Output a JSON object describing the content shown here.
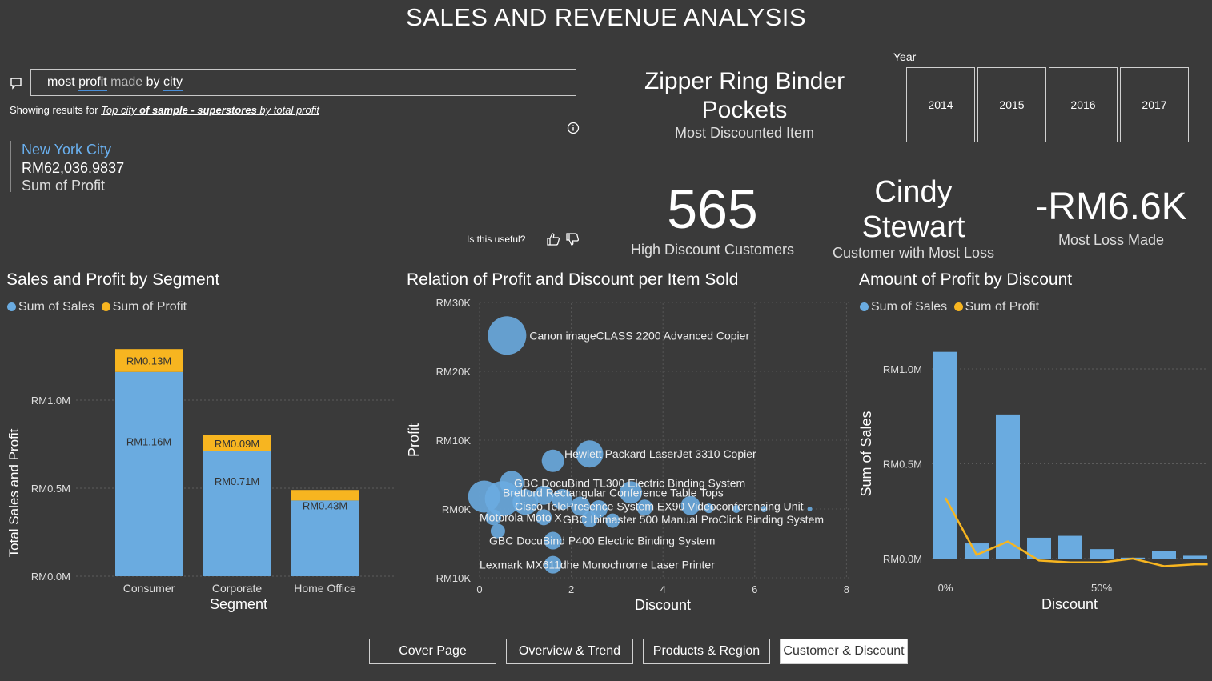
{
  "page": {
    "title": "SALES AND REVENUE ANALYSIS"
  },
  "qa": {
    "query_words": [
      "most",
      "profit",
      "made",
      "by",
      "city"
    ],
    "result_prefix": "Showing results for",
    "result_link_parts": [
      "Top city",
      "of sample - superstores",
      "by total profit"
    ],
    "answer_city": "New York City",
    "answer_value": "RM62,036.9837",
    "answer_measure": "Sum of Profit",
    "useful_prompt": "Is this useful?"
  },
  "most_discounted": {
    "name": "Zipper Ring Binder Pockets",
    "label": "Most Discounted Item"
  },
  "year_slicer": {
    "label": "Year",
    "years": [
      "2014",
      "2015",
      "2016",
      "2017"
    ]
  },
  "kpis": {
    "high_discount_customers": {
      "value": "565",
      "label": "High Discount Customers"
    },
    "most_loss_customer": {
      "name": "Cindy Stewart",
      "label": "Customer with Most Loss"
    },
    "most_loss": {
      "value": "-RM6.6K",
      "label": "Most Loss Made"
    }
  },
  "colors": {
    "sales": "#6aabe0",
    "profit": "#f7b520",
    "background": "#3a3a3a"
  },
  "charts": {
    "segment": {
      "title": "Sales and Profit by Segment",
      "legend": [
        "Sum of Sales",
        "Sum of Profit"
      ],
      "xlabel": "Segment",
      "ylabel": "Total Sales and Profit",
      "yticks": [
        "RM0.0M",
        "RM0.5M",
        "RM1.0M"
      ]
    },
    "scatter": {
      "title": "Relation of Profit and Discount per Item Sold",
      "xlabel": "Discount",
      "ylabel": "Profit",
      "yticks": [
        "-RM10K",
        "RM0K",
        "RM10K",
        "RM20K",
        "RM30K"
      ],
      "xticks": [
        "0",
        "2",
        "4",
        "6",
        "8"
      ]
    },
    "discount": {
      "title": "Amount of Profit by Discount",
      "legend": [
        "Sum of Sales",
        "Sum of Profit"
      ],
      "xlabel": "Discount",
      "ylabel": "Sum of Sales",
      "yticks": [
        "RM0.0M",
        "RM0.5M",
        "RM1.0M"
      ],
      "xticks": [
        "0%",
        "50%"
      ]
    }
  },
  "chart_data": [
    {
      "type": "bar",
      "title": "Sales and Profit by Segment",
      "xlabel": "Segment",
      "ylabel": "Total Sales and Profit",
      "categories": [
        "Consumer",
        "Corporate",
        "Home Office"
      ],
      "series": [
        {
          "name": "Sum of Sales",
          "values": [
            1.16,
            0.71,
            0.43
          ],
          "labels": [
            "RM1.16M",
            "RM0.71M",
            "RM0.43M"
          ]
        },
        {
          "name": "Sum of Profit",
          "values": [
            0.13,
            0.09,
            0.06
          ],
          "labels": [
            "RM0.13M",
            "RM0.09M",
            ""
          ]
        }
      ],
      "stacked": true,
      "unit": "RM millions",
      "ylim": [
        0,
        1.3
      ]
    },
    {
      "type": "scatter",
      "title": "Relation of Profit and Discount per Item Sold",
      "xlabel": "Discount",
      "ylabel": "Profit",
      "xlim": [
        0,
        8
      ],
      "ylim": [
        -10,
        30
      ],
      "unit": "RM thousands",
      "points": [
        {
          "x": 0.6,
          "y": 25.2,
          "r": 24,
          "label": "Canon imageCLASS 2200 Advanced Copier"
        },
        {
          "x": 2.4,
          "y": 8.0,
          "r": 17,
          "label": "Hewlett Packard LaserJet 3310 Copier"
        },
        {
          "x": 1.6,
          "y": 7.0,
          "r": 14,
          "label": ""
        },
        {
          "x": 0.7,
          "y": 3.8,
          "r": 15,
          "label": "GBC DocuBind TL300 Electric Binding System"
        },
        {
          "x": 3.3,
          "y": 2.4,
          "r": 14,
          "label": "Bretford Rectangular Conference Table Tops"
        },
        {
          "x": 0.1,
          "y": 1.8,
          "r": 20,
          "label": ""
        },
        {
          "x": 0.5,
          "y": 1.5,
          "r": 22,
          "label": ""
        },
        {
          "x": 1.0,
          "y": 1.0,
          "r": 16,
          "label": ""
        },
        {
          "x": 1.4,
          "y": 2.0,
          "r": 12,
          "label": ""
        },
        {
          "x": 1.8,
          "y": 1.4,
          "r": 13,
          "label": ""
        },
        {
          "x": 2.2,
          "y": 0.4,
          "r": 12,
          "label": "Cisco TelePresence System EX90 Videoconferencing Unit"
        },
        {
          "x": 2.6,
          "y": 0.0,
          "r": 11,
          "label": ""
        },
        {
          "x": 3.6,
          "y": 0.2,
          "r": 10,
          "label": ""
        },
        {
          "x": 4.6,
          "y": 0.5,
          "r": 12,
          "label": ""
        },
        {
          "x": 5.0,
          "y": 0.1,
          "r": 6,
          "label": ""
        },
        {
          "x": 5.6,
          "y": 0.0,
          "r": 5,
          "label": ""
        },
        {
          "x": 6.2,
          "y": 0.0,
          "r": 4,
          "label": ""
        },
        {
          "x": 7.2,
          "y": 0.0,
          "r": 3,
          "label": ""
        },
        {
          "x": 0.3,
          "y": -1.2,
          "r": 10,
          "label": "Motorola Moto X"
        },
        {
          "x": 1.4,
          "y": -1.2,
          "r": 10,
          "label": ""
        },
        {
          "x": 2.4,
          "y": -1.5,
          "r": 10,
          "label": "GBC Ibimaster 500 Manual ProClick Binding System"
        },
        {
          "x": 2.9,
          "y": -1.7,
          "r": 9,
          "label": ""
        },
        {
          "x": 0.4,
          "y": -3.2,
          "r": 9,
          "label": ""
        },
        {
          "x": 1.6,
          "y": -4.6,
          "r": 11,
          "label": "GBC DocuBind P400 Electric Binding System"
        },
        {
          "x": 1.6,
          "y": -8.1,
          "r": 11,
          "label": "Lexmark MX611dhe Monochrome Laser Printer"
        }
      ]
    },
    {
      "type": "bar",
      "title": "Amount of Profit by Discount",
      "xlabel": "Discount",
      "ylabel": "Sum of Sales",
      "categories": [
        "0%",
        "10%",
        "20%",
        "30%",
        "40%",
        "50%",
        "60%",
        "70%",
        "80%"
      ],
      "series": [
        {
          "name": "Sum of Sales",
          "values": [
            1.09,
            0.08,
            0.76,
            0.11,
            0.12,
            0.05,
            0.005,
            0.04,
            0.015
          ]
        },
        {
          "name": "Sum of Profit",
          "type": "line",
          "values": [
            0.32,
            0.02,
            0.09,
            -0.01,
            -0.02,
            -0.02,
            0.0,
            -0.04,
            -0.03
          ]
        }
      ],
      "xticks": [
        "0%",
        "50%"
      ],
      "unit": "RM millions",
      "ylim": [
        0,
        1.1
      ]
    }
  ],
  "nav": {
    "buttons": [
      "Cover Page",
      "Overview & Trend",
      "Products & Region",
      "Customer & Discount"
    ],
    "active_index": 3
  }
}
